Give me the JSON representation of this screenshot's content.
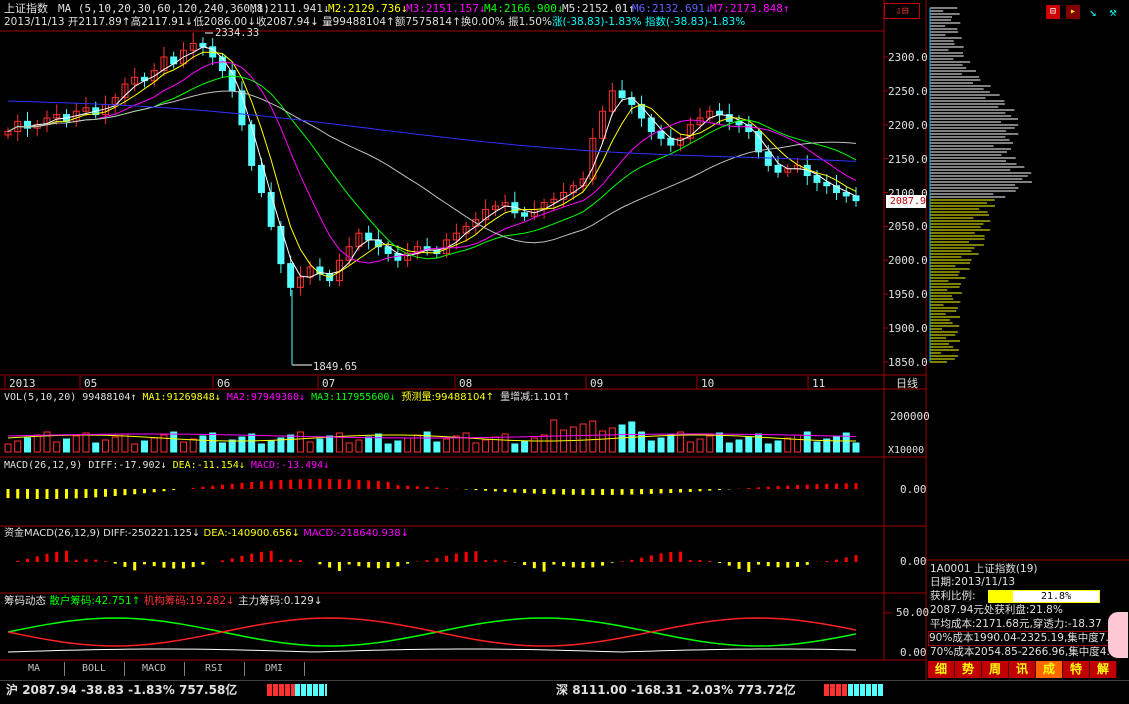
{
  "header": {
    "index_name": "上证指数",
    "ma_label": "MA (5,10,20,30,60,120,240,360,8)",
    "m1": "M1:2111.941↓",
    "m2": "M2:2129.736↓",
    "m3": "M3:2151.157↓",
    "m4": "M4:2166.900↓",
    "m5": "M5:2152.01↑",
    "m6": "M6:2132.691↓",
    "m7": "M7:2173.848↑",
    "date": "2013/11/13",
    "open": "开2117.89↑",
    "high": "高2117.91↓",
    "low": "低2086.00↓",
    "close": "收2087.94↓",
    "volume": "量99488104↑",
    "amount": "额7575814↑",
    "turnover": "换0.00%",
    "amplitude": "振1.50%",
    "change": "涨(-38.83)-1.83%",
    "index_change": "指数(-38.83)-1.83%"
  },
  "price_axis": {
    "labels": [
      "2300.0",
      "2250.0",
      "2200.0",
      "2150.0",
      "2100.0",
      "2050.0",
      "2000.0",
      "1950.0",
      "1900.0",
      "1850.0"
    ],
    "current": "2087.9"
  },
  "annotations": {
    "high": "2334.33",
    "low": "1849.65"
  },
  "time_axis": {
    "labels": [
      "2013",
      "05",
      "06",
      "07",
      "08",
      "09",
      "10",
      "11"
    ],
    "period": "日线"
  },
  "vol_panel": {
    "title": "VOL(5,10,20)",
    "value": "99488104↑",
    "ma1": "MA1:91269848↓",
    "ma2": "MA2:97949360↓",
    "ma3": "MA3:117955600↓",
    "forecast": "预测量:99488104↑",
    "ratio": "量增减:1.101↑",
    "axis_top": "200000",
    "axis_unit": "X10000"
  },
  "macd_panel": {
    "title": "MACD(26,12,9)",
    "diff": "DIFF:-17.902↓",
    "dea": "DEA:-11.154↓",
    "macd": "MACD:-13.494↓",
    "axis": "0.00"
  },
  "fund_macd_panel": {
    "title": "资金MACD(26,12,9)",
    "diff": "DIFF:-250221.125↓",
    "dea": "DEA:-140900.656↓",
    "macd": "MACD:-218640.938↓",
    "axis": "0.00"
  },
  "chip_panel": {
    "title": "筹码动态",
    "retail": "散户筹码:42.751↑",
    "inst": "机构筹码:19.282↓",
    "main": "主力筹码:0.129↓",
    "axis_top": "50.00",
    "axis_bottom": "0.00"
  },
  "tabs": [
    "MA",
    "BOLL",
    "MACD",
    "RSI",
    "DMI"
  ],
  "side": {
    "code": "1A0001  上证指数(19)",
    "date": "日期:2013/11/13",
    "profit_label": "获利比例:",
    "profit_value": "21.8%",
    "profit_ratio": 0.218,
    "line1": "2087.94元处获利盘:21.8%",
    "line2": "平均成本:2171.68元,穿透力:-18.37",
    "line3": "90%成本1990.04-2325.19,集中度7.8",
    "line4": "70%成本2054.85-2266.96,集中度4.9",
    "tabs": [
      "细",
      "势",
      "周",
      "讯",
      "成",
      "特",
      "解"
    ]
  },
  "status": {
    "sh_label": "沪",
    "sh_price": "2087.94",
    "sh_change": "-38.83",
    "sh_pct": "-1.83%",
    "sh_amount": "757.58亿",
    "sz_label": "深",
    "sz_price": "8111.00",
    "sz_change": "-168.31",
    "sz_pct": "-2.03%",
    "sz_amount": "773.72亿"
  },
  "colors": {
    "up": "#ff3030",
    "down": "#54ffff",
    "ma1": "#ffffff",
    "ma2": "#ffff00",
    "ma3": "#ff00ff",
    "ma4": "#00ff00",
    "ma6": "#3030ff"
  },
  "chart_data": {
    "type": "candlestick",
    "ylim": [
      1840,
      2340
    ],
    "closes": [
      2190,
      2205,
      2195,
      2200,
      2210,
      2215,
      2205,
      2220,
      2225,
      2215,
      2230,
      2240,
      2260,
      2270,
      2265,
      2280,
      2300,
      2290,
      2310,
      2320,
      2315,
      2300,
      2280,
      2250,
      2200,
      2140,
      2100,
      2050,
      1995,
      1960,
      1975,
      1990,
      1980,
      1970,
      2000,
      2020,
      2040,
      2030,
      2020,
      2010,
      2000,
      2010,
      2020,
      2015,
      2010,
      2030,
      2040,
      2050,
      2060,
      2075,
      2080,
      2085,
      2070,
      2065,
      2075,
      2085,
      2090,
      2100,
      2110,
      2120,
      2180,
      2220,
      2250,
      2240,
      2230,
      2210,
      2190,
      2180,
      2170,
      2180,
      2200,
      2210,
      2220,
      2215,
      2205,
      2200,
      2190,
      2160,
      2140,
      2130,
      2135,
      2140,
      2125,
      2115,
      2110,
      2100,
      2095,
      2087.94
    ],
    "ma_levels": {
      "M1": 2111.941,
      "M2": 2129.736,
      "M3": 2151.157,
      "M4": 2166.9,
      "M5": 2152.01,
      "M6": 2132.691,
      "M7": 2173.848
    }
  }
}
